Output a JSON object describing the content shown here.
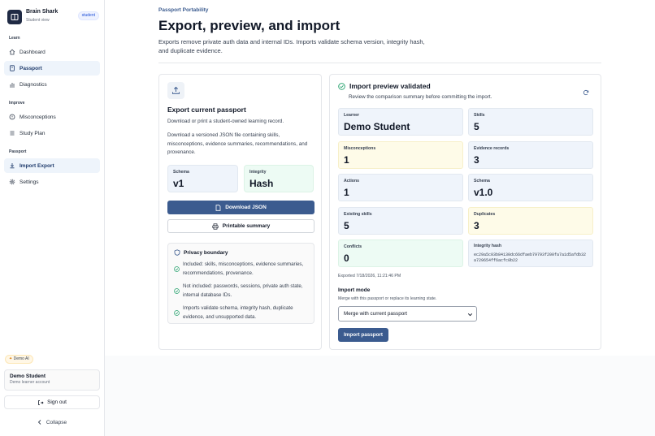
{
  "brand": {
    "name": "Brain Shark",
    "subtitle": "Student view",
    "role": "student"
  },
  "sidebar": {
    "sections": [
      {
        "title": "Learn",
        "items": [
          {
            "label": "Dashboard",
            "icon": "home-icon",
            "active": false
          },
          {
            "label": "Passport",
            "icon": "passport-icon",
            "active": true
          },
          {
            "label": "Diagnostics",
            "icon": "chart-icon",
            "active": false
          }
        ]
      },
      {
        "title": "Improve",
        "items": [
          {
            "label": "Misconceptions",
            "icon": "alert-circle-icon",
            "active": false
          },
          {
            "label": "Study Plan",
            "icon": "list-icon",
            "active": false
          }
        ]
      },
      {
        "title": "Passport",
        "items": [
          {
            "label": "Import Export",
            "icon": "download-icon",
            "active": true
          },
          {
            "label": "Settings",
            "icon": "gear-icon",
            "active": false
          }
        ]
      }
    ],
    "demo_chip": "Demo AI",
    "user": {
      "name": "Demo Student",
      "subtitle": "Demo learner account"
    },
    "sign_out": "Sign out",
    "collapse": "Collapse"
  },
  "header": {
    "eyebrow": "Passport Portability",
    "title": "Export, preview, and import",
    "description": "Exports remove private auth data and internal IDs. Imports validate schema version, integrity hash, and duplicate evidence."
  },
  "export": {
    "title": "Export current passport",
    "text1": "Download or print a student-owned learning record.",
    "text2": "Download a versioned JSON file containing skills, misconceptions, evidence summaries, recommendations, and provenance.",
    "schema": {
      "label": "Schema",
      "value": "v1"
    },
    "integrity": {
      "label": "Integrity",
      "value": "Hash"
    },
    "download_btn": "Download JSON",
    "print_btn": "Printable summary",
    "privacy": {
      "title": "Privacy boundary",
      "items": [
        "Included: skills, misconceptions, evidence summaries, recommendations, provenance.",
        "Not included: passwords, sessions, private auth state, internal database IDs.",
        "Imports validate schema, integrity hash, duplicate evidence, and unsupported data."
      ]
    }
  },
  "import": {
    "title": "Import preview validated",
    "subtitle": "Review the comparison summary before committing the import.",
    "learner": {
      "label": "Learner",
      "value": "Demo Student"
    },
    "skills": {
      "label": "Skills",
      "value": "5"
    },
    "misconceptions": {
      "label": "Misconceptions",
      "value": "1"
    },
    "evidence": {
      "label": "Evidence records",
      "value": "3"
    },
    "actions": {
      "label": "Actions",
      "value": "1"
    },
    "schema": {
      "label": "Schema",
      "value": "v1.0"
    },
    "existing": {
      "label": "Existing skills",
      "value": "5"
    },
    "duplicates": {
      "label": "Duplicates",
      "value": "3"
    },
    "conflicts": {
      "label": "Conflicts",
      "value": "0"
    },
    "hash": {
      "label": "Integrity hash",
      "value": "ec29a5c03b84130dc66dfaeb79793f200fa7a1d5afdb32a729654ff6acfc0b22"
    },
    "exported": "Exported 7/18/2026, 11:21:46 PM",
    "mode_label": "Import mode",
    "mode_help": "Merge with this passport or replace its learning state.",
    "mode_selected": "Merge with current passport",
    "import_btn": "Import passport"
  },
  "colors": {
    "accent": "#3b5b8f",
    "brand_dark": "#1f2a44",
    "success": "#22a06b"
  }
}
